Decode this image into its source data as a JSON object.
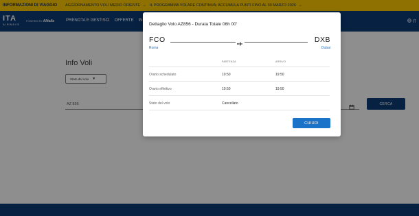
{
  "alert_bar": {
    "title": "INFORMAZIONI DI VIAGGIO",
    "link1": "AGGIORNAMENTO VOLI MEDIO ORIENTE",
    "link2": "IL PROGRAMMA VOLARE CONTINUA: ACCUMULA PUNTI FINO AL 30 MARZO 2026",
    "arrow": "→"
  },
  "nav": {
    "logo_main": "ITA",
    "logo_sub": "AIRWAYS",
    "powered_by": "POWERED BY",
    "powered_brand": "Alitalia",
    "items": [
      "PRENOTA E GESTISCI",
      "OFFERTE",
      "INF"
    ],
    "globe_label": "IT"
  },
  "main": {
    "title": "Info Voli",
    "status_select": "Stato del volo",
    "flight_input_value": "AZ 856",
    "search_button": "CERCA"
  },
  "modal": {
    "title": "Dettaglio Volo AZ856  - Durata Totale 06h 00'",
    "from_code": "FCO",
    "from_city": "Roma",
    "to_code": "DXB",
    "to_city": "Dubai",
    "col_departure": "PARTENZA",
    "col_arrival": "ARRIVO",
    "rows": [
      {
        "label": "Orario schedulato",
        "departure": "10:50",
        "arrival": "19:50"
      },
      {
        "label": "Orario effettivo",
        "departure": "10:50",
        "arrival": "19:50"
      },
      {
        "label": "Stato del volo",
        "departure": "Cancellato",
        "arrival": ""
      }
    ],
    "close_button": "CHIUDI"
  },
  "colors": {
    "alert_yellow": "#f5c300",
    "nav_blue": "#0d3a73",
    "button_blue": "#1a72c9",
    "city_blue": "#2a6fb4"
  }
}
